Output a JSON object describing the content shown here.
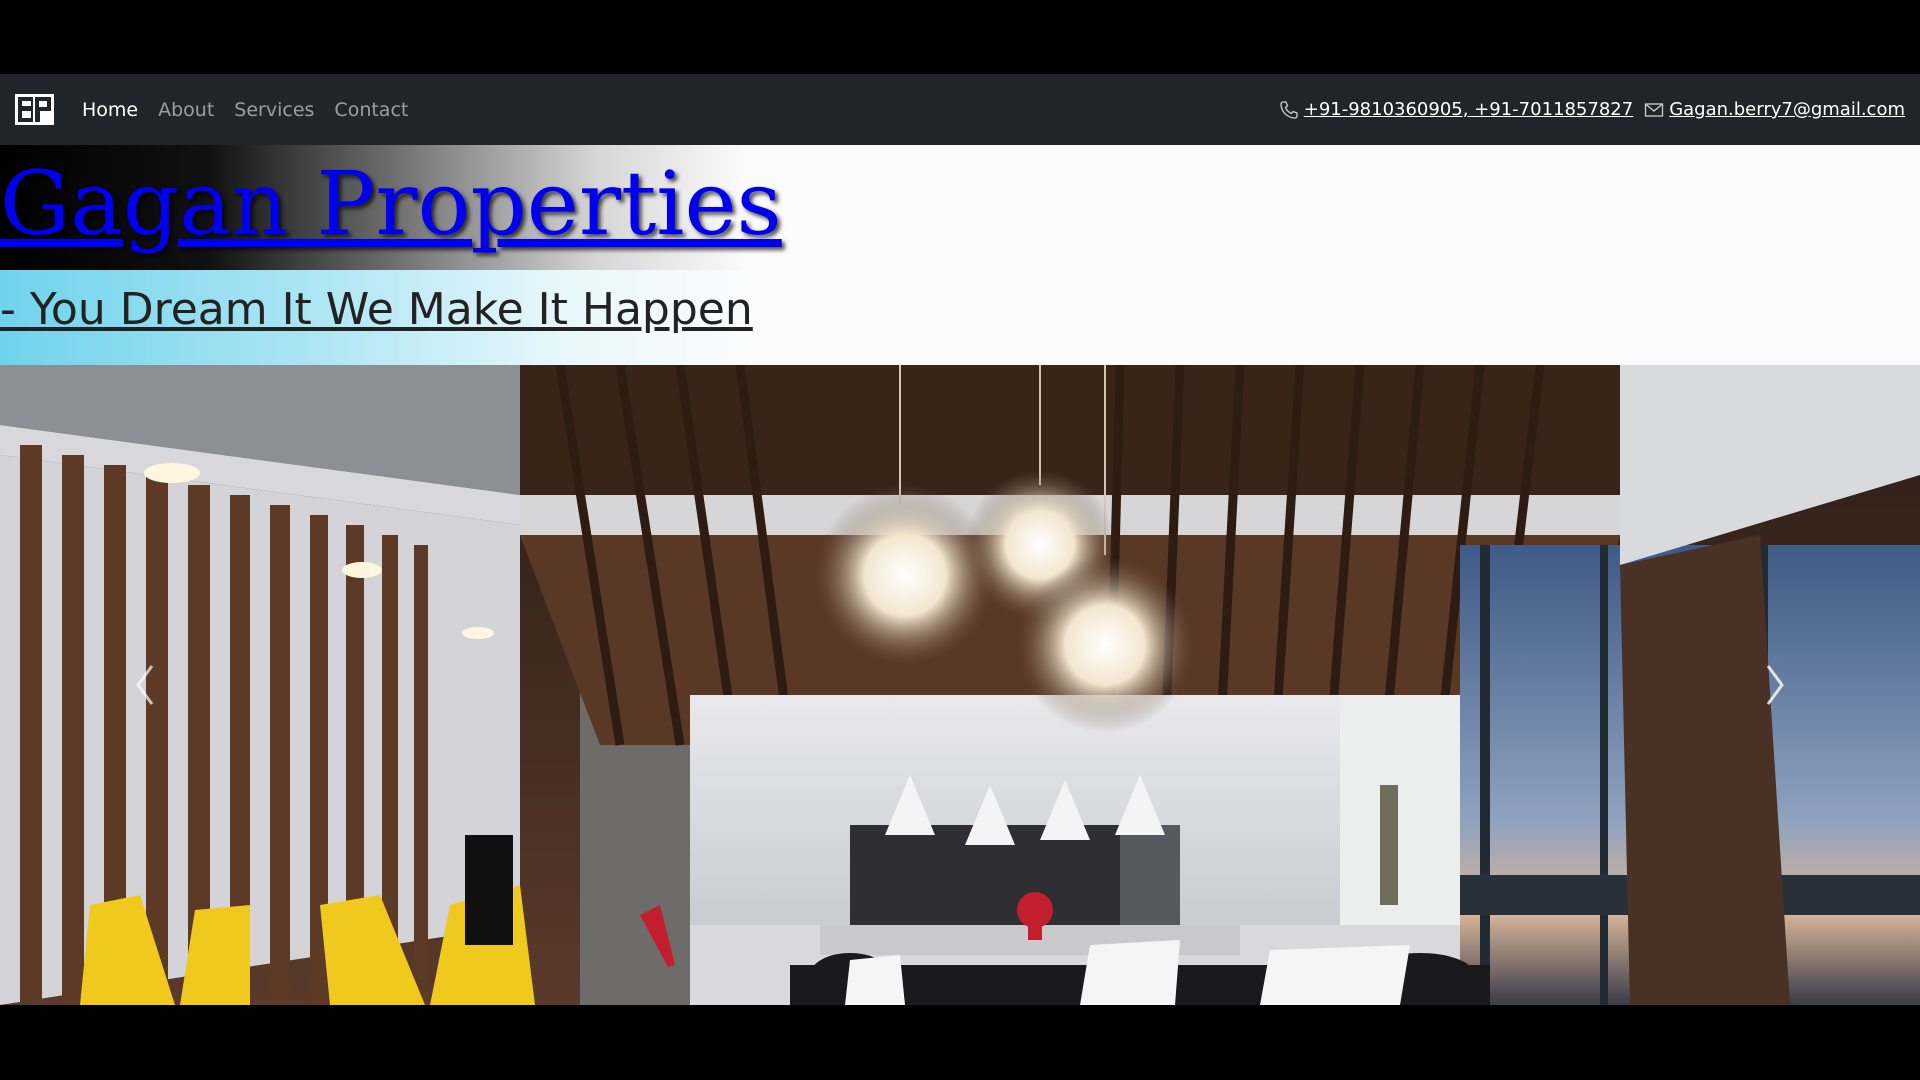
{
  "navbar": {
    "links": [
      {
        "label": "Home",
        "active": true
      },
      {
        "label": "About",
        "active": false
      },
      {
        "label": "Services",
        "active": false
      },
      {
        "label": "Contact",
        "active": false
      }
    ],
    "phone_label": "+91-9810360905,   +91-7011857827 ",
    "email_label": " Gagan.berry7@gmail.com"
  },
  "header": {
    "title": "Gagan Properties",
    "tagline": "- You Dream It We Make It Happen"
  },
  "icons": {
    "logo": "gp-logo-icon",
    "phone": "phone-icon",
    "email": "envelope-icon",
    "prev": "chevron-left-icon",
    "next": "chevron-right-icon"
  },
  "colors": {
    "navbar_bg": "#212529",
    "title_link": "#0000ee",
    "tagline_accent": "#6fd3ec"
  }
}
